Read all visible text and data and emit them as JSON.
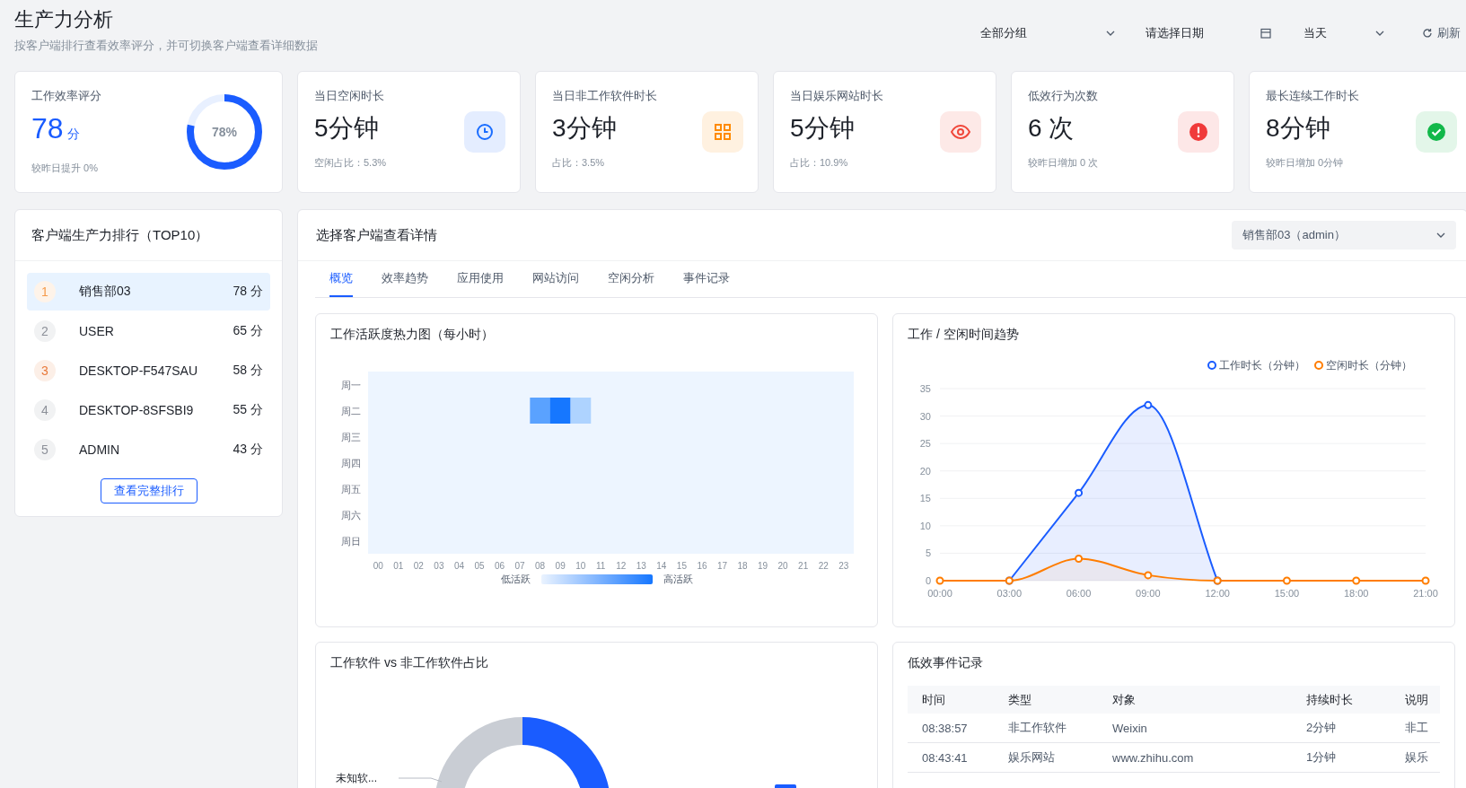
{
  "page": {
    "title": "生产力分析",
    "subtitle": "按客户端排行查看效率评分，并可切换客户端查看详细数据"
  },
  "filters": {
    "group": "全部分组",
    "date_placeholder": "请选择日期",
    "range": "当天",
    "refresh": "刷新"
  },
  "stats": [
    {
      "kind": "gauge",
      "label": "工作效率评分",
      "value": "78",
      "unit": "分",
      "note": "较昨日提升 0%",
      "level": 0.78,
      "gauge_label": "78%"
    },
    {
      "kind": "clock",
      "color": "#1a6dff",
      "label": "当日空闲时长",
      "value": "5分钟",
      "note": "空闲占比：5.3%"
    },
    {
      "kind": "grid",
      "color": "#ff8a00",
      "label": "当日非工作软件时长",
      "value": "3分钟",
      "note": "占比：3.5%"
    },
    {
      "kind": "eye",
      "color": "#f0473a",
      "label": "当日娱乐网站时长",
      "value": "5分钟",
      "note": "占比：10.9%"
    },
    {
      "kind": "alert",
      "color": "#f03a3a",
      "label": "低效行为次数",
      "value": "6 次",
      "note": "较昨日增加 0 次"
    },
    {
      "kind": "check",
      "color": "#12b84a",
      "label": "最长连续工作时长",
      "value": "8分钟",
      "note": "较昨日增加 0分钟"
    }
  ],
  "ranking": {
    "title": "客户端生产力排行（TOP10）",
    "items": [
      {
        "rank": "1",
        "name": "销售部03",
        "score": "78 分",
        "selected": true,
        "color": "#f59a4a"
      },
      {
        "rank": "2",
        "name": "USER",
        "score": "65 分",
        "selected": false,
        "color": "#8c9099"
      },
      {
        "rank": "3",
        "name": "DESKTOP-F547SAU",
        "score": "58 分",
        "selected": false,
        "color": "#e8793a"
      },
      {
        "rank": "4",
        "name": "DESKTOP-8SFSBI9",
        "score": "55 分",
        "selected": false,
        "color": "#8c9099"
      },
      {
        "rank": "5",
        "name": "ADMIN",
        "score": "43 分",
        "selected": false,
        "color": "#8c9099"
      }
    ],
    "more": "查看完整排行"
  },
  "detail": {
    "title": "选择客户端查看详情",
    "client": "销售部03（admin）",
    "tabs": [
      {
        "label": "概览",
        "selected": true
      },
      {
        "label": "效率趋势",
        "selected": false
      },
      {
        "label": "应用使用",
        "selected": false
      },
      {
        "label": "网站访问",
        "selected": false
      },
      {
        "label": "空闲分析",
        "selected": false
      },
      {
        "label": "事件记录",
        "selected": false
      }
    ],
    "heatmap": {
      "title": "工作活跃度热力图（每小时）",
      "legend_low": "低活跃",
      "legend_high": "高活跃",
      "hours": [
        "00",
        "01",
        "02",
        "03",
        "04",
        "05",
        "06",
        "07",
        "08",
        "09",
        "10",
        "11",
        "12",
        "13",
        "14",
        "15",
        "16",
        "17",
        "18",
        "19",
        "20",
        "21",
        "22",
        "23"
      ],
      "days": [
        "周一",
        "周二",
        "周三",
        "周四",
        "周五",
        "周六",
        "周日"
      ]
    },
    "trend": {
      "title": "工作 / 空闲时间趋势",
      "chart_data": {
        "type": "line",
        "categories": [
          "00:00",
          "03:00",
          "06:00",
          "09:00",
          "12:00",
          "15:00",
          "18:00",
          "21:00"
        ],
        "series": [
          {
            "name": "工作时长（分钟）",
            "color": "#1a5cff",
            "marker": "circle",
            "values": [
              null,
              0,
              16,
              32,
              0,
              null,
              null,
              null
            ]
          },
          {
            "name": "空闲时长（分钟）",
            "color": "#ff7d00",
            "marker": "circle",
            "values": [
              0,
              0,
              4,
              1,
              0,
              0,
              0,
              0
            ]
          }
        ],
        "ylim": [
          0,
          35
        ],
        "yticks": [
          0,
          5,
          10,
          15,
          20,
          25,
          30,
          35
        ],
        "grid": true,
        "legend": true
      }
    },
    "share": {
      "title": "工作软件 vs 非工作软件占比",
      "slice_label": "未知软..."
    },
    "events": {
      "title": "低效事件记录",
      "columns": [
        "时间",
        "类型",
        "对象",
        "持续时长",
        "说明"
      ],
      "rows": [
        {
          "cells": [
            "08:38:57",
            "非工作软件",
            "Weixin",
            "2分钟",
            "非工"
          ]
        },
        {
          "cells": [
            "08:43:41",
            "娱乐网站",
            "www.zhihu.com",
            "1分钟",
            "娱乐"
          ]
        }
      ]
    }
  }
}
